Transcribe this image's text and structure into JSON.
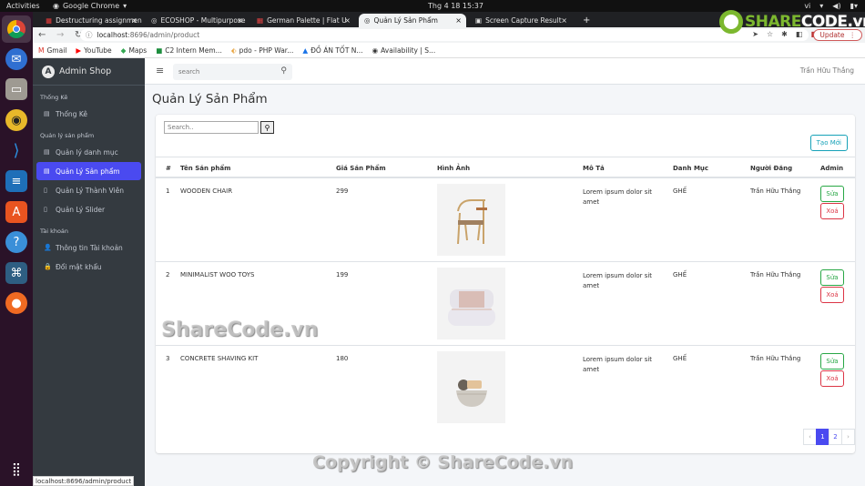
{
  "os": {
    "activities": "Activities",
    "app_name": "Google Chrome",
    "clock": "Thg 4 18  15:37",
    "lang": "vi"
  },
  "browser": {
    "tabs": [
      {
        "label": "Destructuring assignmen",
        "active": false
      },
      {
        "label": "ECOSHOP - Multipurpose",
        "active": false
      },
      {
        "label": "German Palette | Flat U",
        "active": false
      },
      {
        "label": "Quản Lý Sản Phẩm",
        "active": true
      },
      {
        "label": "Screen Capture Result",
        "active": false
      }
    ],
    "new_tab": "+",
    "url_host": "localhost",
    "url_rest": ":8696/admin/product",
    "update_label": "Update",
    "bookmarks": [
      "Gmail",
      "YouTube",
      "Maps",
      "C2 Intern Mem...",
      "pdo - PHP War...",
      "ĐỒ ÁN TỐT N...",
      "Availability | S..."
    ],
    "status_url": "localhost:8696/admin/product"
  },
  "sidebar": {
    "brand": "Admin Shop",
    "sections": [
      {
        "title": "Thống Kê",
        "items": [
          {
            "label": "Thống Kê",
            "icon": "list-icon",
            "active": false
          }
        ]
      },
      {
        "title": "Quản lý sản phẩm",
        "items": [
          {
            "label": "Quản lý danh mục",
            "icon": "list-icon",
            "active": false
          },
          {
            "label": "Quản Lý Sản phẩm",
            "icon": "list-icon",
            "active": true
          },
          {
            "label": "Quản Lý Thành Viên",
            "icon": "file-icon",
            "active": false
          },
          {
            "label": "Quản Lý Slider",
            "icon": "file-icon",
            "active": false
          }
        ]
      },
      {
        "title": "Tài khoản",
        "items": [
          {
            "label": "Thông tin Tài khoản",
            "icon": "user-icon",
            "active": false
          },
          {
            "label": "Đổi mật khẩu",
            "icon": "lock-icon",
            "active": false
          }
        ]
      }
    ]
  },
  "topnav": {
    "search_placeholder": "search",
    "user_name": "Trần Hữu Thắng"
  },
  "page": {
    "title": "Quản Lý Sản Phẩm",
    "search_placeholder": "Search..",
    "create_label": "Tạo Mới",
    "columns": [
      "#",
      "Tên Sản phẩm",
      "Giá Sản Phẩm",
      "Hình Ảnh",
      "Mô Tả",
      "Danh Mục",
      "Người Đăng",
      "Admin"
    ],
    "rows": [
      {
        "id": "1",
        "name": "WOODEN CHAIR",
        "price": "299",
        "image": "wooden-chair",
        "desc": "Lorem ipsum dolor sit amet",
        "category": "GHẾ",
        "author": "Trần Hữu Thắng"
      },
      {
        "id": "2",
        "name": "MINIMALIST WOO TOYS",
        "price": "199",
        "image": "armchair",
        "desc": "Lorem ipsum dolor sit amet",
        "category": "GHẾ",
        "author": "Trần Hữu Thắng"
      },
      {
        "id": "3",
        "name": "CONCRETE SHAVING KIT",
        "price": "180",
        "image": "shaving-kit",
        "desc": "Lorem ipsum dolor sit amet",
        "category": "GHẾ",
        "author": "Trần Hữu Thắng"
      }
    ],
    "edit_label": "Sửa",
    "delete_label": "Xoá",
    "pagination": {
      "prev": "‹",
      "pages": [
        "1",
        "2"
      ],
      "current": "1",
      "next": "›"
    }
  },
  "watermarks": {
    "logo_text_a": "SHARE",
    "logo_text_b": "CODE.vn",
    "center": "ShareCode.vn",
    "bottom": "Copyright © ShareCode.vn"
  },
  "colors": {
    "accent": "#4a4af0",
    "sidebar_bg": "#343a40",
    "edit": "#28a745",
    "delete": "#dc3545",
    "create": "#17a2b8"
  }
}
